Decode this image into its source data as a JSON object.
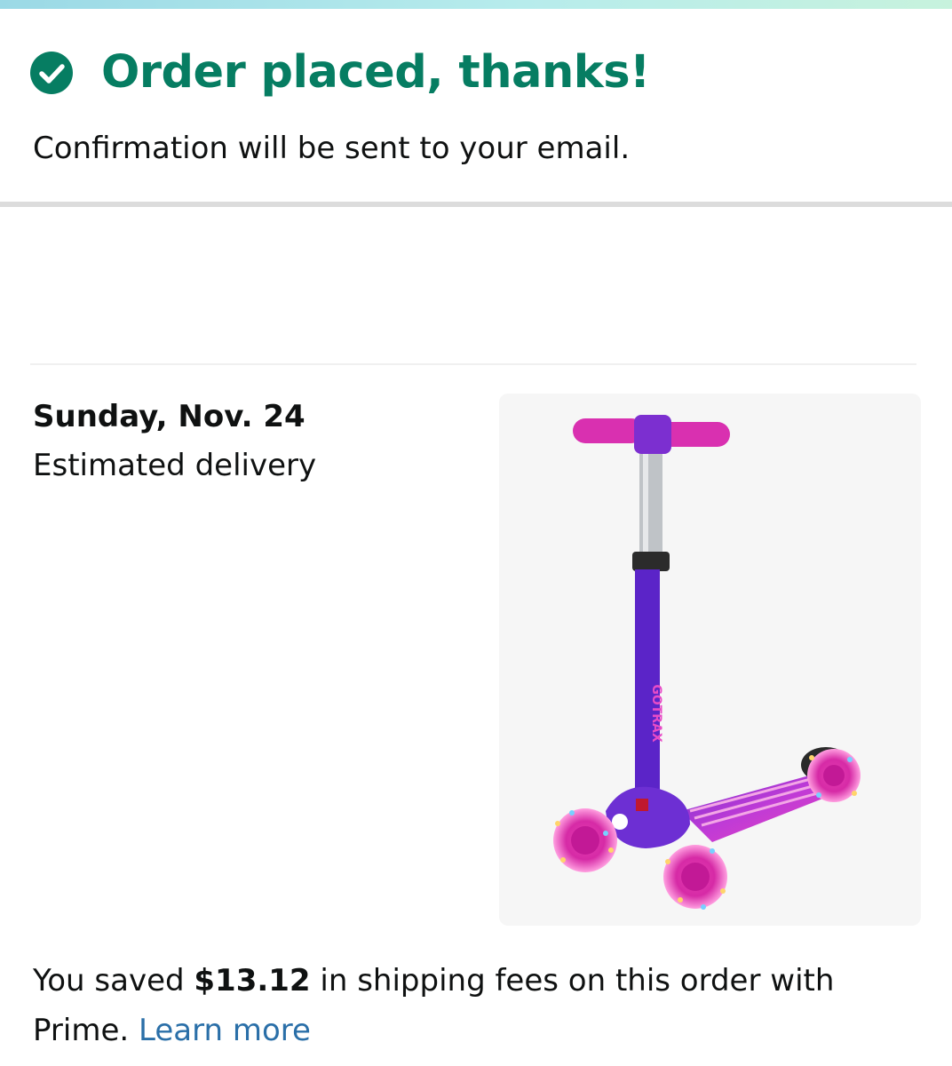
{
  "header": {
    "title": "Order placed, thanks!",
    "subtitle": "Confirmation will be sent to your email."
  },
  "delivery": {
    "date": "Sunday, Nov. 24",
    "label": "Estimated delivery"
  },
  "product": {
    "image_alt": "Kids kick scooter in purple and pink with light-up wheels",
    "brand_mark": "GOTRAX"
  },
  "savings": {
    "prefix": "You saved ",
    "amount": "$13.12",
    "middle": " in shipping fees on this order with Prime.",
    "link": "Learn more"
  },
  "colors": {
    "success_green": "#067d62",
    "link_blue": "#2a6fa8",
    "accent_start": "#9bd9e6",
    "accent_end": "#c7f2dd"
  }
}
